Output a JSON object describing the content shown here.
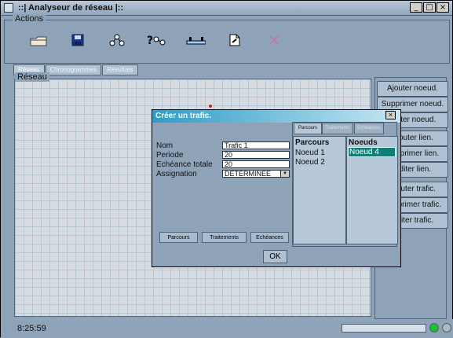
{
  "window": {
    "title": "::| Analyseur de réseau |::",
    "buttons": [
      "_",
      "□",
      "×"
    ]
  },
  "actions": {
    "label": "Actions",
    "tools": [
      "open-folder-icon",
      "save-icon",
      "node-network-icon",
      "traffic-icon",
      "link-icon",
      "document-icon",
      "delete-icon"
    ]
  },
  "tabs": [
    "Réseau",
    "Chronogrammes",
    "Résultats"
  ],
  "network": {
    "label": "Réseau"
  },
  "side_buttons": [
    "Ajouter noeud.",
    "Supprimer noeud.",
    "Editer noeud.",
    "Ajouter lien.",
    "Supprimer lien.",
    "Editer lien.",
    "Ajouter trafic.",
    "Supprimer trafic.",
    "Editer trafic."
  ],
  "dialog": {
    "title": "Créer un trafic.",
    "fields": [
      {
        "label": "Nom",
        "value": "Trafic 1"
      },
      {
        "label": "Periode",
        "value": "20"
      },
      {
        "label": "Echéance totale",
        "value": "20"
      },
      {
        "label": "Assignation",
        "value": "DETERMINEE"
      }
    ],
    "bottom_tabs": [
      "Parcours",
      "Traitements",
      "Echéances"
    ],
    "ok_label": "OK",
    "inner_tabs": [
      "Parcours",
      "Traitements",
      "Echéances"
    ],
    "parcours": {
      "header": "Parcours",
      "items": [
        "Noeud 1",
        "Noeud 2"
      ]
    },
    "noeuds": {
      "header": "Noeuds",
      "items": [
        "Noeud 4"
      ]
    }
  },
  "status": {
    "time": "8:25:59",
    "progress": 0
  },
  "colors": {
    "accent": "#2f9cc5",
    "selected": "#0f7f78",
    "led_green": "#1cc12b"
  }
}
